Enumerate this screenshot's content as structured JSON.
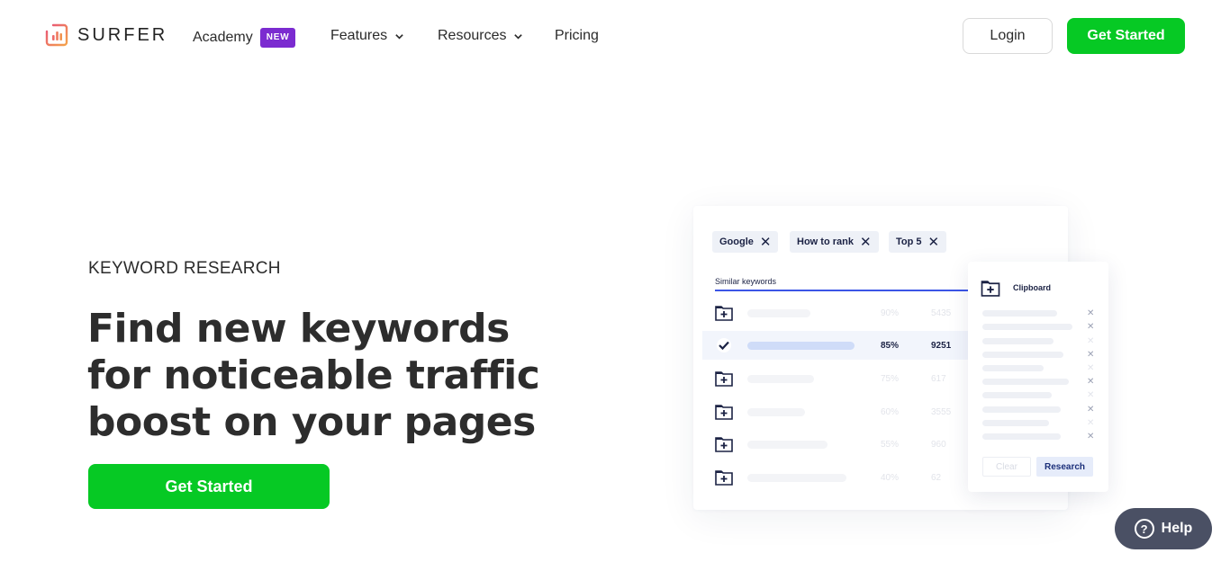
{
  "brand": {
    "name": "SURFER",
    "accent": "#06c924",
    "badge_color": "#7b2bd0"
  },
  "nav": {
    "items": [
      {
        "label": "Academy",
        "badge": "NEW"
      },
      {
        "label": "Features"
      },
      {
        "label": "Resources"
      },
      {
        "label": "Pricing"
      }
    ],
    "login_label": "Login",
    "cta_label": "Get Started"
  },
  "hero": {
    "eyebrow": "KEYWORD RESEARCH",
    "headline_line1": "Find new keywords",
    "headline_line2": "for noticeable traffic",
    "headline_line3": "boost on your pages",
    "cta_label": "Get Started"
  },
  "mock": {
    "chips": [
      "Google",
      "How to rank",
      "Top 5"
    ],
    "similar_label": "Similar keywords",
    "rows": [
      {
        "icon": "add-folder-icon",
        "pct": "90%",
        "vol": "5435",
        "selected": false
      },
      {
        "icon": "check-icon",
        "pct": "85%",
        "vol": "9251",
        "selected": true
      },
      {
        "icon": "add-folder-icon",
        "pct": "75%",
        "vol": "617",
        "selected": false
      },
      {
        "icon": "add-folder-icon",
        "pct": "60%",
        "vol": "3555",
        "selected": false
      },
      {
        "icon": "add-folder-icon",
        "pct": "55%",
        "vol": "960",
        "selected": false
      },
      {
        "icon": "add-folder-icon",
        "pct": "40%",
        "vol": "62",
        "selected": false
      }
    ],
    "clipboard": {
      "title": "Clipboard",
      "clear_label": "Clear",
      "research_label": "Research"
    }
  },
  "help": {
    "label": "Help"
  }
}
